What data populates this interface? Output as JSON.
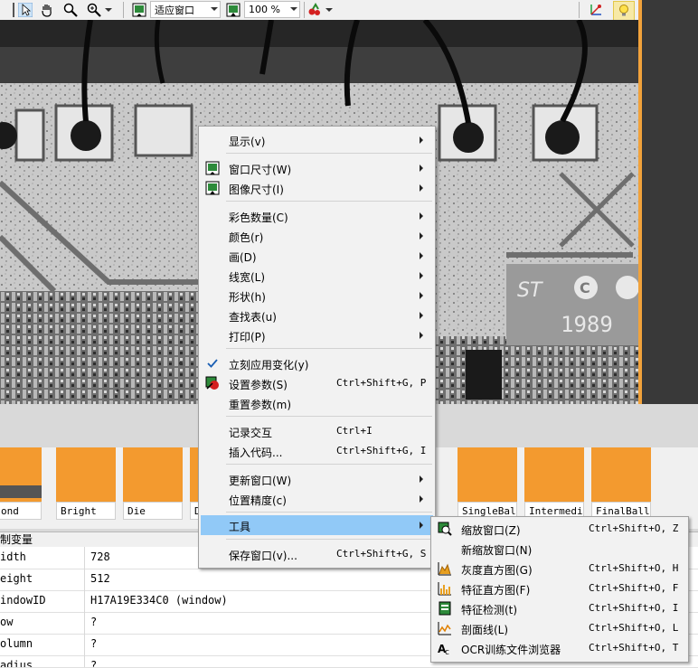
{
  "toolbar": {
    "zoom_mode": "适应窗口",
    "zoom_percent": "100 %"
  },
  "thumbnails": [
    {
      "label": "ond"
    },
    {
      "label": "Bright"
    },
    {
      "label": "Die"
    },
    {
      "label": "D"
    },
    {
      "label": "SingleBall"
    },
    {
      "label": "Intermedia"
    },
    {
      "label": "FinalBalls"
    }
  ],
  "variables": {
    "title": "制变量",
    "rows": [
      {
        "key": "idth",
        "value": "728"
      },
      {
        "key": "eight",
        "value": "512"
      },
      {
        "key": "indowID",
        "value": "H17A19E334C0 (window)"
      },
      {
        "key": "ow",
        "value": "?"
      },
      {
        "key": "olumn",
        "value": "?"
      },
      {
        "key": "adius",
        "value": "?"
      }
    ]
  },
  "context_menu": {
    "items": [
      {
        "label": "显示(v)"
      },
      {
        "label": "窗口尺寸(W)"
      },
      {
        "label": "图像尺寸(I)"
      },
      {
        "label": "彩色数量(C)"
      },
      {
        "label": "颜色(r)"
      },
      {
        "label": "画(D)"
      },
      {
        "label": "线宽(L)"
      },
      {
        "label": "形状(h)"
      },
      {
        "label": "查找表(u)"
      },
      {
        "label": "打印(P)"
      },
      {
        "label": "立刻应用变化(y)"
      },
      {
        "label": "设置参数(S)",
        "shortcut": "Ctrl+Shift+G, P"
      },
      {
        "label": "重置参数(m)"
      },
      {
        "label": "记录交互",
        "shortcut": "Ctrl+I"
      },
      {
        "label": "插入代码...",
        "shortcut": "Ctrl+Shift+G, I"
      },
      {
        "label": "更新窗口(W)"
      },
      {
        "label": "位置精度(c)"
      },
      {
        "label": "工具"
      },
      {
        "label": "保存窗口(v)...",
        "shortcut": "Ctrl+Shift+G, S"
      }
    ]
  },
  "tools_submenu": {
    "items": [
      {
        "label": "缩放窗口(Z)",
        "shortcut": "Ctrl+Shift+O, Z"
      },
      {
        "label": "新缩放窗口(N)",
        "shortcut": ""
      },
      {
        "label": "灰度直方图(G)",
        "shortcut": "Ctrl+Shift+O, H"
      },
      {
        "label": "特征直方图(F)",
        "shortcut": "Ctrl+Shift+O, F"
      },
      {
        "label": "特征检测(t)",
        "shortcut": "Ctrl+Shift+O, I"
      },
      {
        "label": "剖面线(L)",
        "shortcut": "Ctrl+Shift+O, L"
      },
      {
        "label": "OCR训练文件浏览器",
        "shortcut": "Ctrl+Shift+O, T"
      }
    ]
  },
  "die_marking": "1989",
  "colors": {
    "accent_orange": "#f39a2f",
    "menu_highlight": "#91c9f7",
    "menu_background": "#f2f2f2"
  }
}
